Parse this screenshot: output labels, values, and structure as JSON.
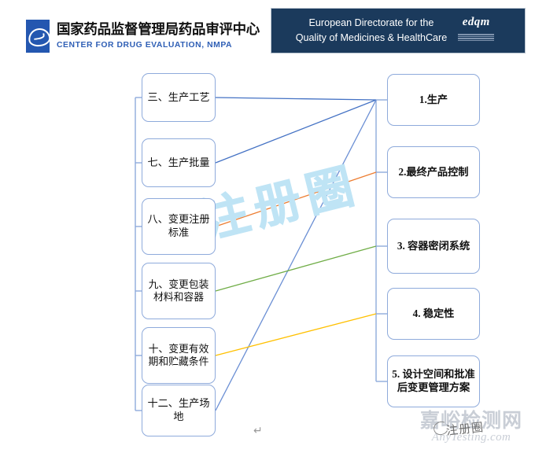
{
  "headers": {
    "nmpa": {
      "cn": "国家药品监督管理局药品审评中心",
      "en": "CENTER FOR DRUG EVALUATION, NMPA",
      "logo_icon": "nmpa-eye-logo-icon",
      "accent": "#2457b0",
      "en_color": "#2f5fb5"
    },
    "edqm": {
      "line1": "European Directorate for the",
      "line2": "Quality of Medicines & HealthCare",
      "logo_word": "edqm",
      "logo_icon": "edqm-logo-icon",
      "background": "#1b3a5c",
      "text_color": "#ffffff",
      "star_color": "#f2c249"
    }
  },
  "diagram": {
    "left_column": [
      {
        "id": "n3",
        "label": "三、生产工艺"
      },
      {
        "id": "n7",
        "label": "七、生产批量"
      },
      {
        "id": "n8",
        "label": "八、变更注册标准"
      },
      {
        "id": "n9",
        "label": "九、变更包装材料和容器"
      },
      {
        "id": "n10",
        "label": "十、变更有效期和贮藏条件"
      },
      {
        "id": "n12",
        "label": "十二、生产场地"
      }
    ],
    "right_column": [
      {
        "id": "r1",
        "label": "1.生产"
      },
      {
        "id": "r2",
        "label": "2.最终产品控制"
      },
      {
        "id": "r3",
        "label": "3. 容器密闭系统"
      },
      {
        "id": "r4",
        "label": "4. 稳定性"
      },
      {
        "id": "r5",
        "label": "5. 设计空间和批准后变更管理方案"
      }
    ],
    "connectors": [
      {
        "from": "n3",
        "to": "r1",
        "color": "#4472c4"
      },
      {
        "from": "n7",
        "to": "r1",
        "color": "#4472c4"
      },
      {
        "from": "n12",
        "to": "r1",
        "color": "#6b8fd4"
      },
      {
        "from": "n8",
        "to": "r2",
        "color": "#ed7d31"
      },
      {
        "from": "n9",
        "to": "r3",
        "color": "#70ad47"
      },
      {
        "from": "n10",
        "to": "r4",
        "color": "#ffc000"
      }
    ],
    "spine_color": "#8eaadb",
    "box_border": "#8eaadb"
  },
  "watermarks": {
    "center": "注册圈",
    "bottom_right_cn": "嘉峪检测网",
    "bottom_right_en": "AnyTesting.com",
    "stamp": "注册圈",
    "center_color": "#bfe4f5"
  },
  "marks": {
    "pilcrow": "↵"
  }
}
